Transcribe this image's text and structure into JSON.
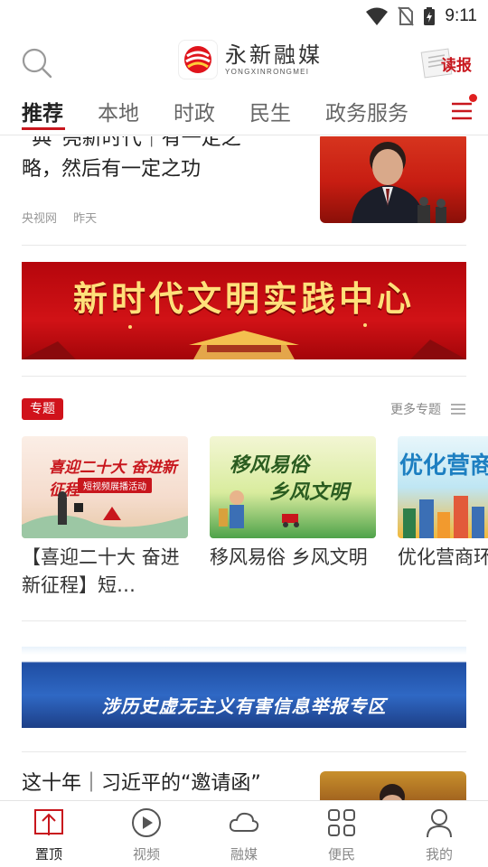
{
  "status_bar": {
    "time": "9:11"
  },
  "header": {
    "logo_cn": "永新融媒",
    "logo_en": "YONGXINRONGMEI",
    "read_paper_label": "读报"
  },
  "tabs": [
    {
      "label": "推荐",
      "active": true
    },
    {
      "label": "本地",
      "active": false
    },
    {
      "label": "时政",
      "active": false
    },
    {
      "label": "民生",
      "active": false
    },
    {
      "label": "政务服务",
      "active": false
    }
  ],
  "feed": {
    "article1": {
      "title_line1": "“典”亮新时代｜有一定之",
      "title_line2": "略，然后有一定之功",
      "source": "央视网",
      "time": "昨天"
    },
    "banner1": {
      "text": "新时代文明实践中心"
    },
    "topics": {
      "tag": "专题",
      "more_label": "更多专题",
      "cards": [
        {
          "title": "【喜迎二十大 奋进新征程】短…",
          "image_text": "喜迎二十大 奋进新征程",
          "image_subtext": "短视频展播活动"
        },
        {
          "title": "移风易俗 乡风文明",
          "image_text_line1": "移风易俗",
          "image_text_line2": "乡风文明"
        },
        {
          "title": "优化营商环境专栏",
          "image_text": "优化营商"
        }
      ]
    },
    "banner2": {
      "text": "涉历史虚无主义有害信息举报专区"
    },
    "article2": {
      "title": "这十年｜习近平的“邀请函”"
    }
  },
  "bottom_nav": [
    {
      "label": "置顶",
      "icon": "arrow-top-icon",
      "active": true
    },
    {
      "label": "视频",
      "icon": "play-icon",
      "active": false
    },
    {
      "label": "融媒",
      "icon": "cloud-icon",
      "active": false
    },
    {
      "label": "便民",
      "icon": "grid-icon",
      "active": false
    },
    {
      "label": "我的",
      "icon": "user-icon",
      "active": false
    }
  ],
  "colors": {
    "accent": "#c8161d",
    "tab_inactive": "#666666"
  }
}
